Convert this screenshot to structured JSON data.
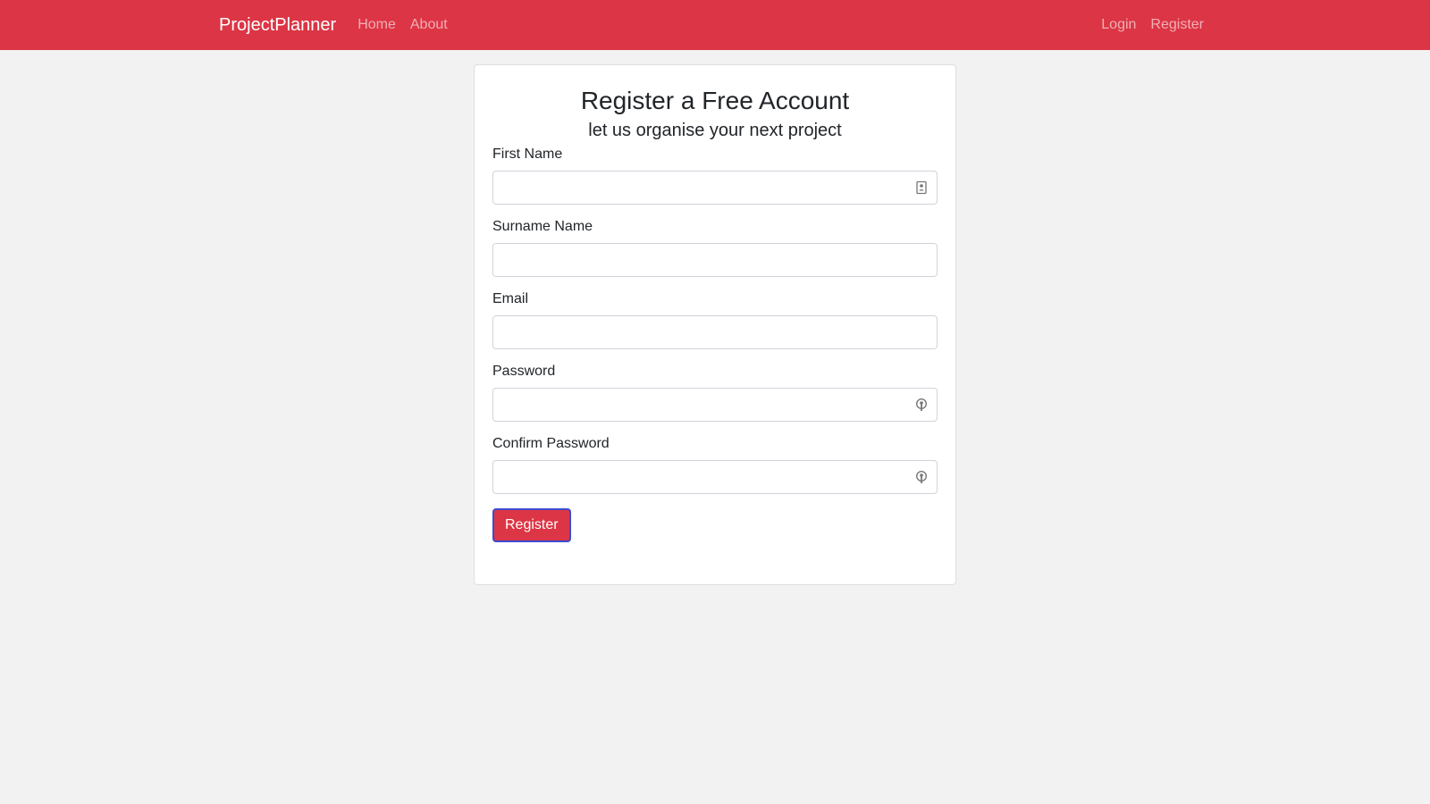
{
  "navbar": {
    "brand": "ProjectPlanner",
    "left_links": [
      {
        "label": "Home"
      },
      {
        "label": "About"
      }
    ],
    "right_links": [
      {
        "label": "Login"
      },
      {
        "label": "Register"
      }
    ],
    "background_color": "#dc3545"
  },
  "form": {
    "title": "Register a Free Account",
    "subtitle": "let us organise your next project",
    "fields": [
      {
        "label": "First Name",
        "value": "",
        "icon": "contact-card-icon"
      },
      {
        "label": "Surname Name",
        "value": ""
      },
      {
        "label": "Email",
        "value": ""
      },
      {
        "label": "Password",
        "value": "",
        "icon": "key-icon"
      },
      {
        "label": "Confirm Password",
        "value": "",
        "icon": "key-icon"
      }
    ],
    "submit_label": "Register",
    "accent_color": "#dc3545"
  }
}
